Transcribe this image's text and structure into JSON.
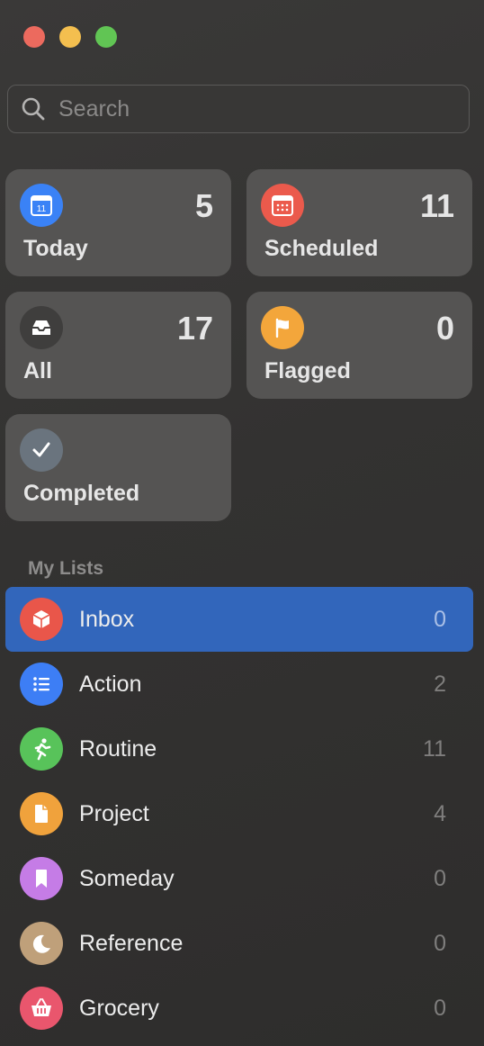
{
  "window": {
    "controls": [
      "close",
      "minimize",
      "zoom"
    ]
  },
  "search": {
    "placeholder": "Search"
  },
  "smart_lists": [
    {
      "label": "Today",
      "count": "5",
      "icon": "calendar-icon",
      "color": "#3a82f6",
      "icon_text": "11"
    },
    {
      "label": "Scheduled",
      "count": "11",
      "icon": "calendar-grid-icon",
      "color": "#eb5a4c"
    },
    {
      "label": "All",
      "count": "17",
      "icon": "tray-icon",
      "color": "#3f3e3d"
    },
    {
      "label": "Flagged",
      "count": "0",
      "icon": "flag-icon",
      "color": "#f3a63b"
    },
    {
      "label": "Completed",
      "count": "",
      "icon": "checkmark-icon",
      "color": "#6a747e"
    }
  ],
  "section_title": "My Lists",
  "lists": [
    {
      "name": "Inbox",
      "count": "0",
      "icon": "cube-icon",
      "color": "#e9564a",
      "selected": true
    },
    {
      "name": "Action",
      "count": "2",
      "icon": "list-bullet-icon",
      "color": "#3d7ef5",
      "selected": false
    },
    {
      "name": "Routine",
      "count": "11",
      "icon": "runner-icon",
      "color": "#58c35a",
      "selected": false
    },
    {
      "name": "Project",
      "count": "4",
      "icon": "document-icon",
      "color": "#f0a23c",
      "selected": false
    },
    {
      "name": "Someday",
      "count": "0",
      "icon": "bookmark-icon",
      "color": "#c57ce6",
      "selected": false
    },
    {
      "name": "Reference",
      "count": "0",
      "icon": "moon-icon",
      "color": "#bfa07a",
      "selected": false
    },
    {
      "name": "Grocery",
      "count": "0",
      "icon": "basket-icon",
      "color": "#e9566d",
      "selected": false
    }
  ]
}
